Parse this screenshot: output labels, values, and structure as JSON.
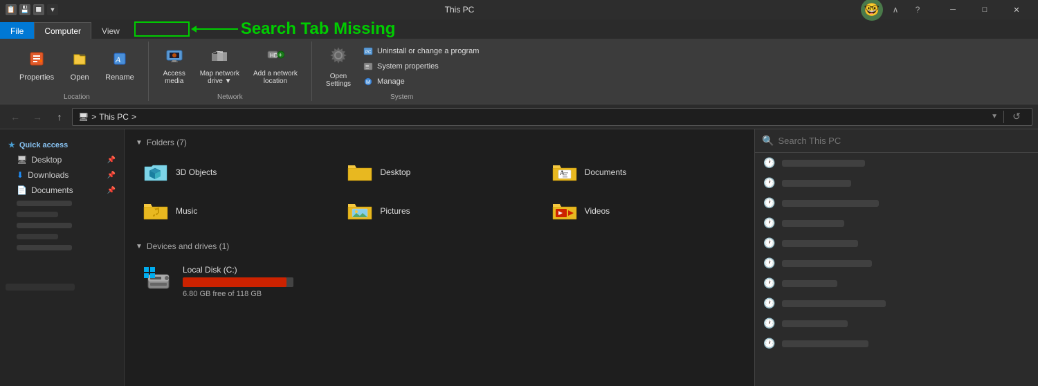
{
  "titleBar": {
    "title": "This PC",
    "minimize": "─",
    "maximize": "□",
    "close": "✕",
    "chevronUp": "∧",
    "helpIcon": "?"
  },
  "ribbon": {
    "tabs": [
      {
        "id": "file",
        "label": "File"
      },
      {
        "id": "computer",
        "label": "Computer"
      },
      {
        "id": "view",
        "label": "View"
      },
      {
        "id": "search",
        "label": ""
      }
    ],
    "groups": [
      {
        "id": "location",
        "label": "Location",
        "buttons": [
          {
            "id": "properties",
            "icon": "🔴",
            "label": "Properties"
          },
          {
            "id": "open",
            "icon": "📂",
            "label": "Open"
          },
          {
            "id": "rename",
            "icon": "✏️",
            "label": "Rename"
          }
        ]
      },
      {
        "id": "network",
        "label": "Network",
        "buttons": [
          {
            "id": "access-media",
            "icon": "📺",
            "label": "Access\nmedia"
          },
          {
            "id": "map-network",
            "icon": "🗺️",
            "label": "Map network\ndrive"
          },
          {
            "id": "add-network",
            "icon": "➕",
            "label": "Add a network\nlocation"
          }
        ]
      },
      {
        "id": "system",
        "label": "System",
        "buttons_large": [
          {
            "id": "open-settings",
            "icon": "⚙️",
            "label": "Open\nSettings"
          }
        ],
        "buttons_small": [
          {
            "id": "uninstall",
            "label": "Uninstall or change a program"
          },
          {
            "id": "system-props",
            "label": "System properties"
          },
          {
            "id": "manage",
            "label": "Manage"
          }
        ]
      }
    ],
    "annotation": {
      "arrowText": "Search Tab Missing"
    }
  },
  "navBar": {
    "backBtn": "←",
    "forwardBtn": "→",
    "upBtn": "↑",
    "addressParts": [
      "🖥",
      "This PC",
      ">"
    ],
    "refreshIcon": "↺"
  },
  "sidebar": {
    "quickAccess": "Quick access",
    "desktop": "Desktop",
    "downloads": "Downloads",
    "documents": "Documents",
    "items": []
  },
  "content": {
    "folders": {
      "sectionLabel": "Folders (7)",
      "items": [
        {
          "id": "3d-objects",
          "name": "3D Objects",
          "type": "3d"
        },
        {
          "id": "desktop",
          "name": "Desktop",
          "type": "yellow"
        },
        {
          "id": "documents",
          "name": "Documents",
          "type": "document"
        },
        {
          "id": "music",
          "name": "Music",
          "type": "music"
        },
        {
          "id": "pictures",
          "name": "Pictures",
          "type": "pictures"
        },
        {
          "id": "videos",
          "name": "Videos",
          "type": "videos"
        }
      ]
    },
    "devices": {
      "sectionLabel": "Devices and drives (1)",
      "items": [
        {
          "id": "local-disk-c",
          "name": "Local Disk (C:)",
          "freeSpace": "6.80 GB free of 118 GB",
          "fillPercent": 94
        }
      ]
    }
  },
  "searchPanel": {
    "placeholder": "Search This PC",
    "historyCount": 10,
    "historyWidths": [
      120,
      100,
      140,
      90,
      110,
      130,
      80,
      150,
      95,
      125
    ]
  }
}
